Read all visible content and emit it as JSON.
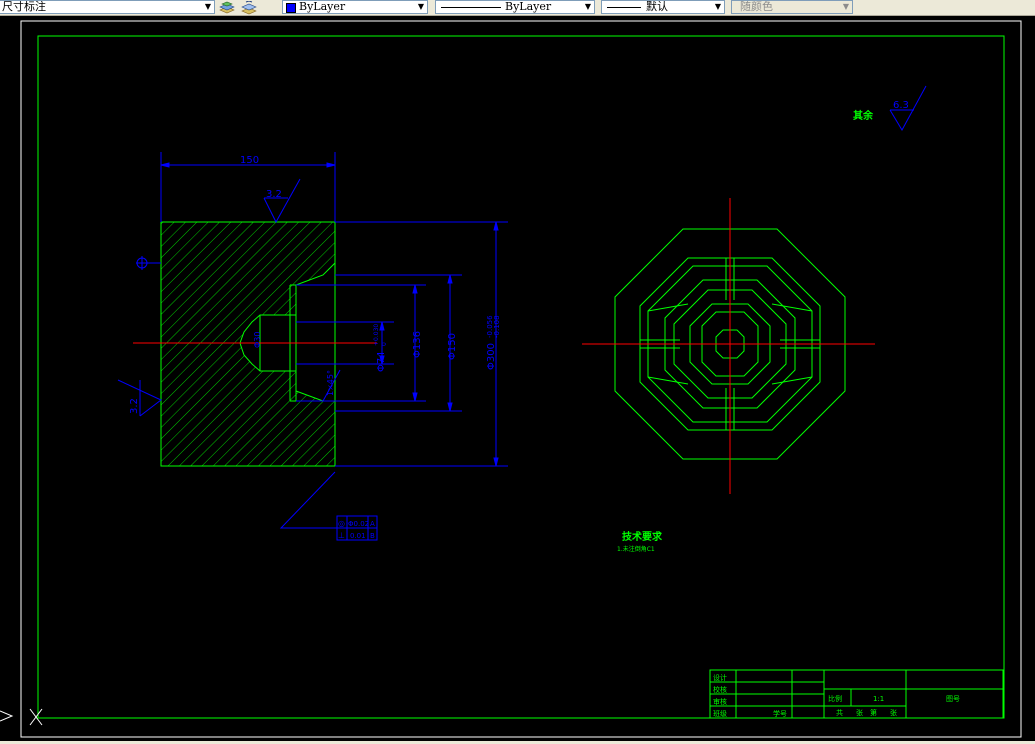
{
  "toolbar": {
    "dimstyle": "尺寸标注",
    "color": "ByLayer",
    "linetype": "ByLayer",
    "lineweight": "默认",
    "plotstyle": "随颜色",
    "icons": [
      "layer-manager-icon",
      "layer-previous-icon"
    ]
  },
  "colors": {
    "background": "#000000",
    "part": "#00ff00",
    "dimension": "#0000ff",
    "centerline": "#ff0000",
    "title_text": "#00ff00"
  },
  "drawing": {
    "roughness_top": "3.2",
    "roughness_left": "3.2",
    "roughness_other": "6.3",
    "roughness_other_label": "其余",
    "dim_length": "150",
    "dim_bore_small": "Φ74",
    "dim_bore_small_tol": "+0.030",
    "dim_bore_small_tol2": "0",
    "dim_bore_mid": "Φ136",
    "dim_bore_large": "Φ150",
    "dim_outer": "Φ300",
    "dim_outer_tol": "-0.056",
    "dim_outer_tol2": "-0.108",
    "dim_chamfer": "1×45°",
    "dim_hole": "Φ30",
    "datum": "B",
    "fcf_row1": [
      "◎",
      "Φ0.02",
      "A"
    ],
    "fcf_row2": [
      "⊥",
      "0.01",
      "B"
    ]
  },
  "notes": {
    "title": "技术要求",
    "line1": "1.未注倒角C1"
  },
  "title_block": {
    "rows": [
      "设计",
      "校核",
      "审核",
      "班级"
    ],
    "student_no_label": "学号",
    "scale_label": "比例",
    "scale_value": "1:1",
    "drawing_no": "图号",
    "sheet_words": [
      "共",
      "张",
      "第",
      "张"
    ]
  }
}
